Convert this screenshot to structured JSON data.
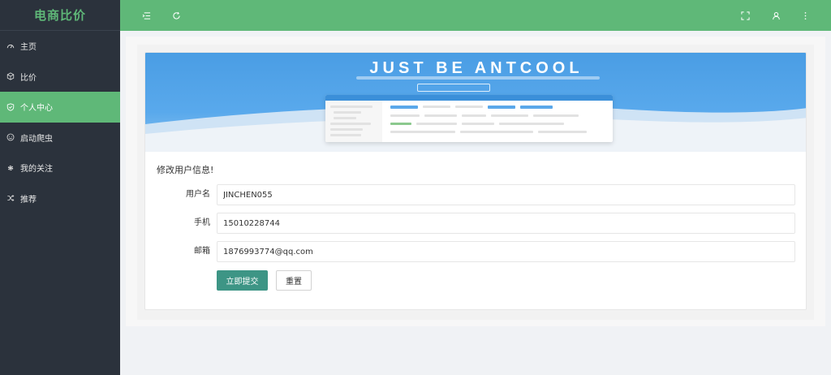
{
  "sidebar": {
    "logo": "电商比价",
    "items": [
      {
        "label": "主页",
        "icon": "dashboard-icon",
        "active": false
      },
      {
        "label": "比价",
        "icon": "cube-icon",
        "active": false
      },
      {
        "label": "个人中心",
        "icon": "shield-icon",
        "active": true
      },
      {
        "label": "启动爬虫",
        "icon": "smile-icon",
        "active": false
      },
      {
        "label": "我的关注",
        "icon": "gear-icon",
        "active": false
      },
      {
        "label": "推荐",
        "icon": "shuffle-icon",
        "active": false
      }
    ]
  },
  "topbar": {
    "left_icons": [
      "menu-fold-icon",
      "refresh-icon"
    ],
    "right_icons": [
      "fullscreen-icon",
      "user-icon",
      "more-vertical-icon"
    ]
  },
  "banner": {
    "title": "JUST BE ANTCOOL"
  },
  "form": {
    "title": "修改用户信息!",
    "fields": [
      {
        "label": "用户名",
        "value": "JINCHEN055"
      },
      {
        "label": "手机",
        "value": "15010228744"
      },
      {
        "label": "邮箱",
        "value": "1876993774@qq.com"
      }
    ],
    "submit_label": "立即提交",
    "reset_label": "重置"
  },
  "colors": {
    "accent": "#5fb878",
    "sidebar_bg": "#2b323c",
    "submit_bg": "#3d9585"
  }
}
